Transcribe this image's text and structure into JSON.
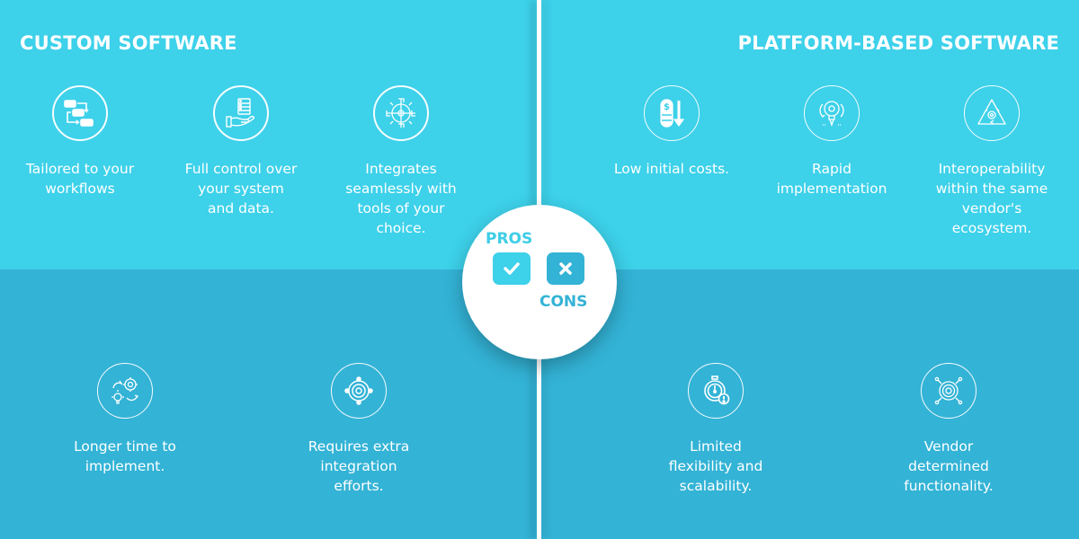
{
  "custom": {
    "title": "CUSTOM SOFTWARE",
    "pros": [
      {
        "icon": "workflow-flowchart-icon",
        "label_lines": [
          "Tailored to your",
          "workflows"
        ]
      },
      {
        "icon": "hand-holding-server-icon",
        "label_lines": [
          "Full control over",
          "your system",
          "and data."
        ]
      },
      {
        "icon": "puzzle-gear-icon",
        "label_lines": [
          "Integrates",
          "seamlessly with",
          "tools of your",
          "choice."
        ]
      }
    ],
    "cons": [
      {
        "icon": "gears-lightbulb-icon",
        "label_lines": [
          "Longer time to",
          "implement."
        ]
      },
      {
        "icon": "integration-gear-icon",
        "label_lines": [
          "Requires extra",
          "integration",
          "efforts."
        ]
      }
    ]
  },
  "platform": {
    "title": "PLATFORM-BASED SOFTWARE",
    "pros": [
      {
        "icon": "coins-down-arrow-icon",
        "label_lines": [
          "Low initial costs."
        ]
      },
      {
        "icon": "idea-lightbulb-cycle-icon",
        "label_lines": [
          "Rapid",
          "implementation"
        ]
      },
      {
        "icon": "triangle-cycle-gear-icon",
        "label_lines": [
          "Interoperability",
          "within the same",
          "vendor's",
          "ecosystem."
        ]
      }
    ],
    "cons": [
      {
        "icon": "stopwatch-warning-icon",
        "label_lines": [
          "Limited",
          "flexibility and",
          "scalability."
        ]
      },
      {
        "icon": "gear-network-icon",
        "label_lines": [
          "Vendor",
          "determined",
          "functionality."
        ]
      }
    ]
  },
  "badge": {
    "pros_label": "PROS",
    "cons_label": "CONS"
  },
  "colors": {
    "pros_bg": "#3dd1ea",
    "cons_bg": "#33b3d6",
    "text": "#ffffff"
  }
}
